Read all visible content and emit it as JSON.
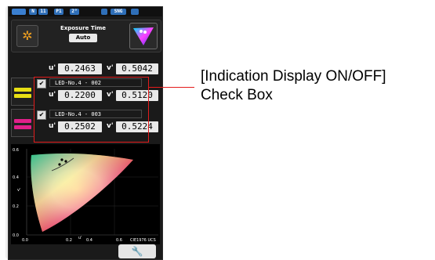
{
  "status_bar": {
    "chips": [
      "N",
      "11",
      "P1",
      "2°",
      "SNG"
    ]
  },
  "exposure": {
    "label": "Exposure Time",
    "value": "Auto"
  },
  "measurement": {
    "u_label": "u'",
    "u": "0.2463",
    "v_label": "v'",
    "v": "0.5042"
  },
  "leds": [
    {
      "name": "LED-No.4 - 002",
      "checked": true,
      "u_label": "u'",
      "u": "0.2200",
      "v_label": "v'",
      "v": "0.5120",
      "swatch_color": "#e8df14"
    },
    {
      "name": "LED-No.4 - 003",
      "checked": true,
      "u_label": "u'",
      "u": "0.2502",
      "v_label": "v'",
      "v": "0.5224",
      "swatch_color": "#e0208a"
    }
  ],
  "diagram": {
    "y_ticks": [
      "0.6",
      "0.4",
      "0.2",
      "0.0"
    ],
    "x_ticks": [
      "0.0",
      "0.2",
      "0.4",
      "0.6"
    ],
    "y_label": "v'",
    "x_label": "u'",
    "standard": "CIE1976 UCS"
  },
  "tool_button": {
    "icon": "wrench-icon"
  },
  "callout": {
    "line1": "[Indication Display ON/OFF]",
    "line2": "Check Box",
    "color": "#e31b1b"
  }
}
